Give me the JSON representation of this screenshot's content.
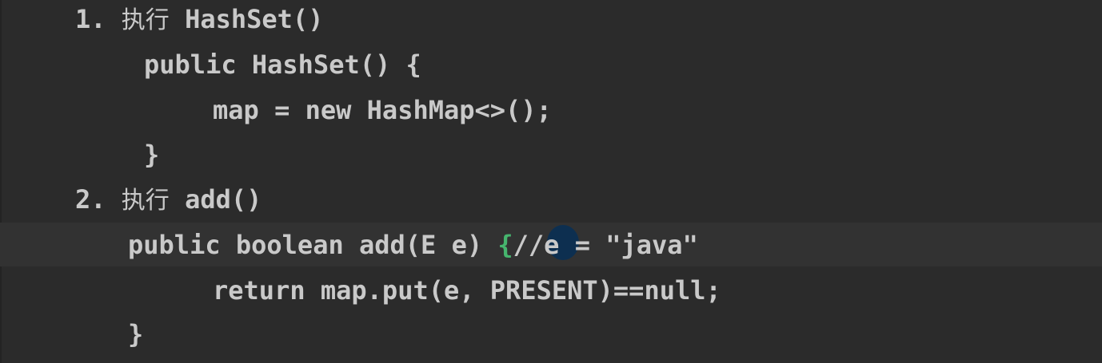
{
  "code": {
    "line1": {
      "number": "1.",
      "label": "执行",
      "text": "HashSet()"
    },
    "line2": "public HashSet() {",
    "line3": "map = new HashMap<>();",
    "line4": "}",
    "line5": {
      "number": "2.",
      "label": "执行",
      "text": "add()"
    },
    "line6": {
      "before": "public boolean add(E e) ",
      "brace": "{",
      "after": "//e = \"java\""
    },
    "line7": "return map.put(e, PRESENT)==null;",
    "line8": "}"
  },
  "colors": {
    "background": "#2b2b2b",
    "current_line": "#323232",
    "text": "#c9c9c9",
    "brace_match": "#46b56e",
    "cursor_spot": "#0c2f52"
  }
}
